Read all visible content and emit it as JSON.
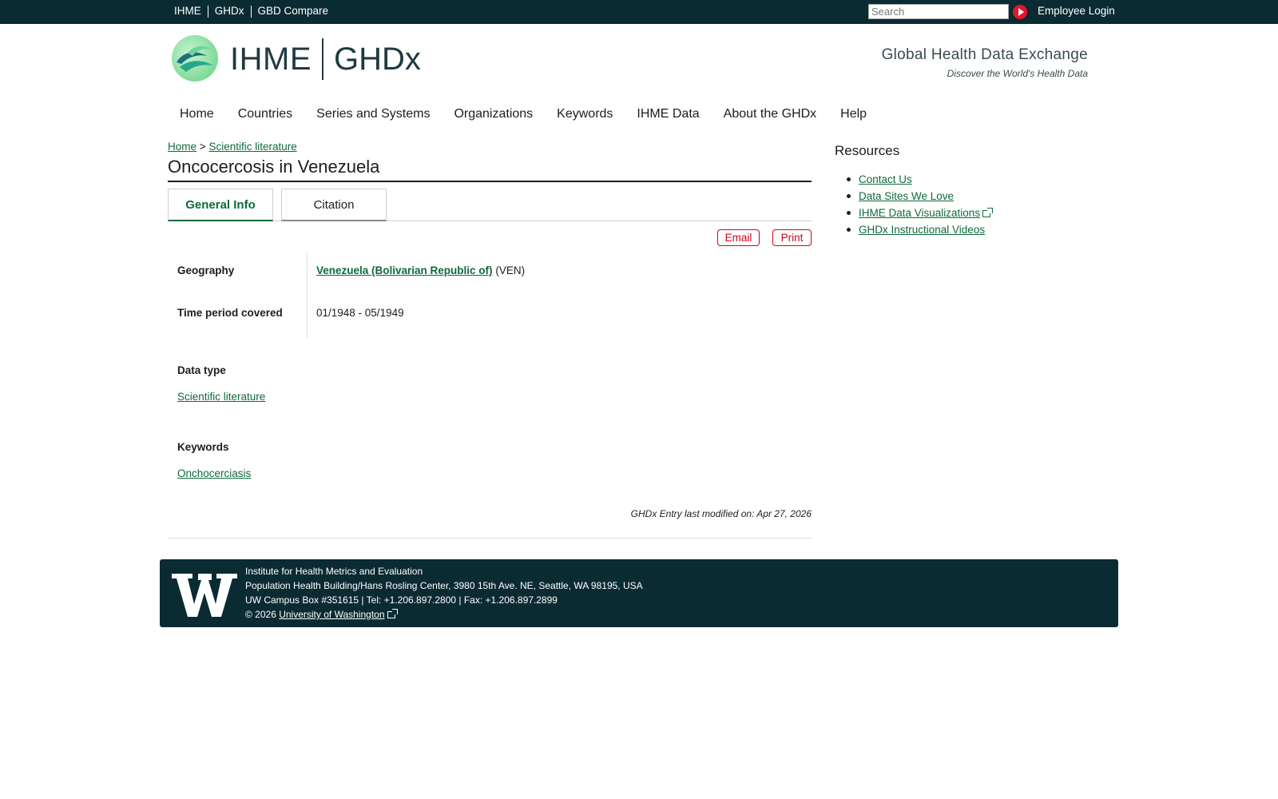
{
  "topbar": {
    "links": [
      "IHME",
      "GHDx",
      "GBD Compare"
    ],
    "search_placeholder": "Search",
    "employee_login": "Employee Login"
  },
  "header": {
    "logo_name": "IHME",
    "logo_product": "GHDx",
    "tagline_title": "Global Health Data Exchange",
    "tagline_subtitle": "Discover the World's Health Data"
  },
  "mainnav": {
    "items": [
      "Home",
      "Countries",
      "Series and Systems",
      "Organizations",
      "Keywords",
      "IHME Data",
      "About the GHDx",
      "Help"
    ]
  },
  "breadcrumb": {
    "home": "Home",
    "separator": ">",
    "current": "Scientific literature"
  },
  "page": {
    "title": "Oncocercosis in Venezuela",
    "tabs": [
      "General Info",
      "Citation"
    ],
    "email_button": "Email",
    "print_button": "Print",
    "geography_label": "Geography",
    "geography_link": "Venezuela (Bolivarian Republic of)",
    "geography_code": "(VEN)",
    "time_label": "Time period covered",
    "time_value": "01/1948 - 05/1949",
    "data_type_label": "Data type",
    "data_type_value": "Scientific literature",
    "keywords_label": "Keywords",
    "keywords_value": "Onchocerciasis",
    "modified": "GHDx Entry last modified on: Apr 27, 2026"
  },
  "sidebar": {
    "title": "Resources",
    "items": [
      "Contact Us",
      "Data Sites We Love",
      "IHME Data Visualizations",
      "GHDx Instructional Videos"
    ]
  },
  "footer": {
    "line1": "Institute for Health Metrics and Evaluation",
    "line2": "Population Health Building/Hans Rosling Center, 3980 15th Ave. NE, Seattle, WA 98195, USA",
    "line3": "UW Campus Box #351615 | Tel: +1.206.897.2800 | Fax: +1.206.897.2899",
    "copyright": "© 2026",
    "uw_link": "University of Washington"
  },
  "colors": {
    "topbar_bg": "#0b2b33",
    "link_green": "#0e6a3d",
    "button_red": "#d0021b",
    "search_go": "#e8152a"
  },
  "icons": {
    "search_go": "play-arrow-icon",
    "external": "external-link-icon",
    "logo": "ihme-leaf-logo",
    "footer_logo": "uw-w-logo"
  }
}
